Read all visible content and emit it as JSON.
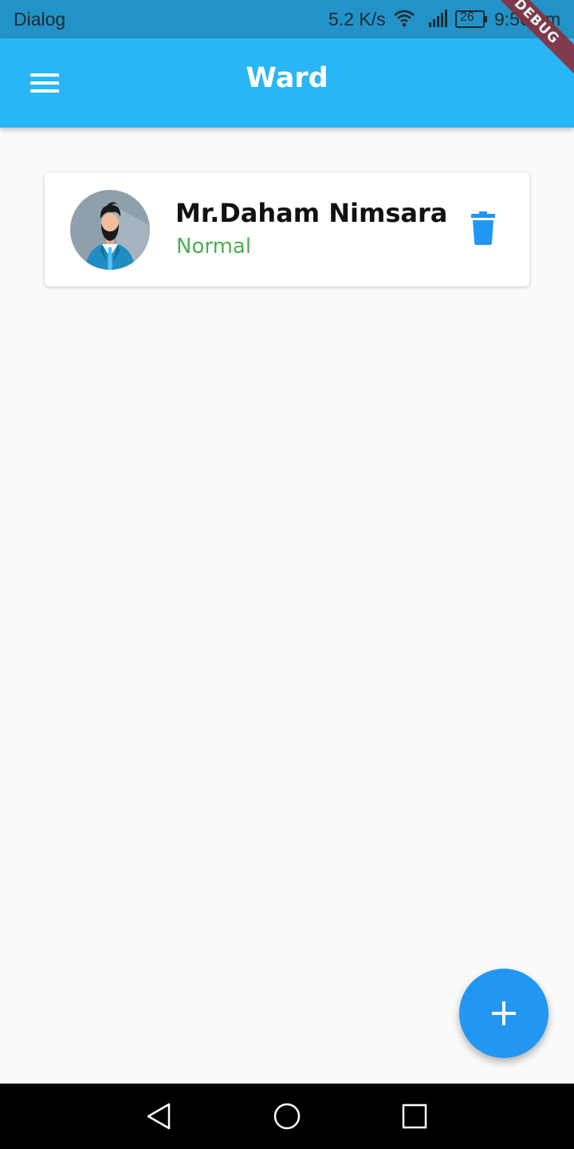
{
  "status_bar": {
    "left_text": "Dialog",
    "network_speed": "5.2 K/s",
    "battery_level": "26",
    "time": "9:56 am",
    "icons": [
      "wifi-icon",
      "signal-icon",
      "battery-icon"
    ]
  },
  "debug_banner": "DEBUG",
  "app_bar": {
    "title": "Ward",
    "menu_icon": "menu-icon"
  },
  "patients": [
    {
      "name": "Mr.Daham Nimsara",
      "status": "Normal",
      "status_color": "#4caf50",
      "avatar": "bearded-man-avatar",
      "action_icon": "delete-icon"
    }
  ],
  "fab": {
    "icon": "add-icon",
    "color": "#2196f3"
  },
  "colors": {
    "status_bar": "#2293c8",
    "app_bar": "#29b6f6",
    "background": "#fafafa",
    "delete_icon": "#2196f3"
  },
  "nav_bar": {
    "icons": [
      "back-icon",
      "home-icon",
      "recents-icon"
    ]
  }
}
